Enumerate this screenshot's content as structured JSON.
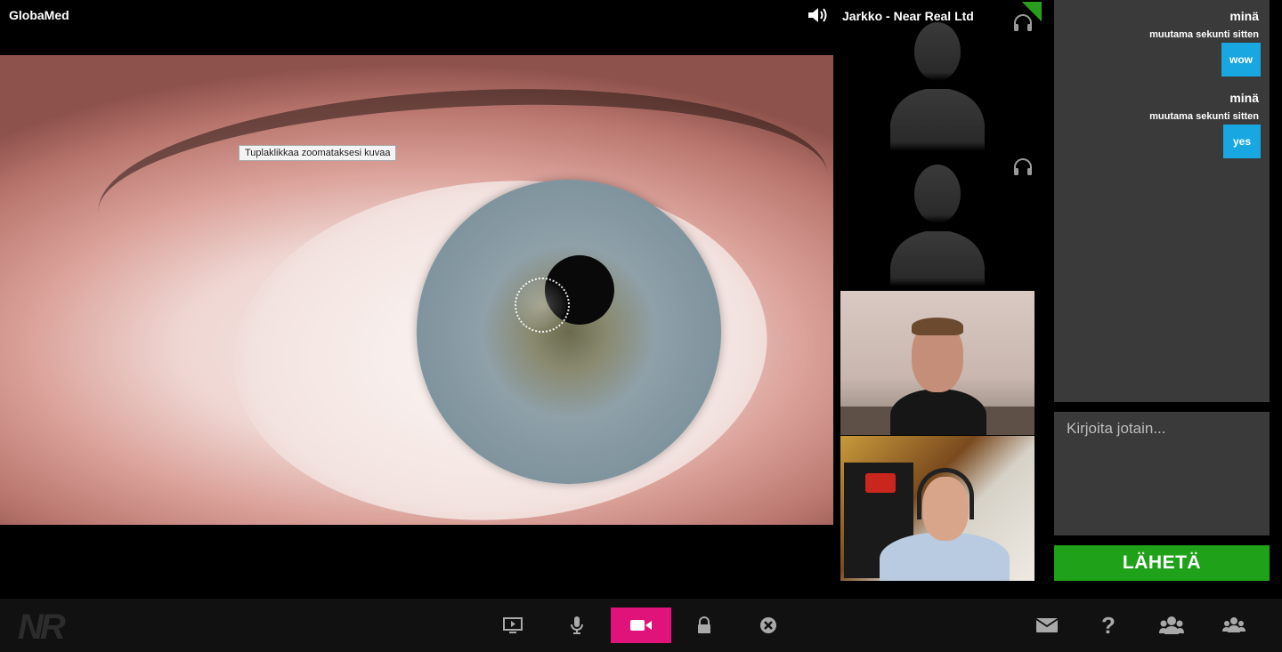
{
  "app": {
    "title": "GlobaMed"
  },
  "main_video": {
    "tooltip": "Tuplaklikkaa zoomataksesi kuvaa"
  },
  "participants": {
    "name": "Jarkko - Near Real Ltd"
  },
  "chat": {
    "messages": [
      {
        "author": "minä",
        "time": "muutama sekunti sitten",
        "text": "wow"
      },
      {
        "author": "minä",
        "time": "muutama sekunti sitten",
        "text": "yes"
      }
    ],
    "input_placeholder": "Kirjoita jotain...",
    "send_label": "LÄHETÄ"
  },
  "toolbar": {
    "logo": "NR",
    "help_label": "?",
    "buttons": [
      "screen-share-icon",
      "microphone-icon",
      "camera-icon",
      "lock-icon",
      "close-icon",
      "mail-icon",
      "help-icon",
      "participants-icon",
      "group-icon"
    ],
    "active_color": "#e0137a",
    "send_color": "#1fa11a",
    "bubble_color": "#18a7e0"
  }
}
